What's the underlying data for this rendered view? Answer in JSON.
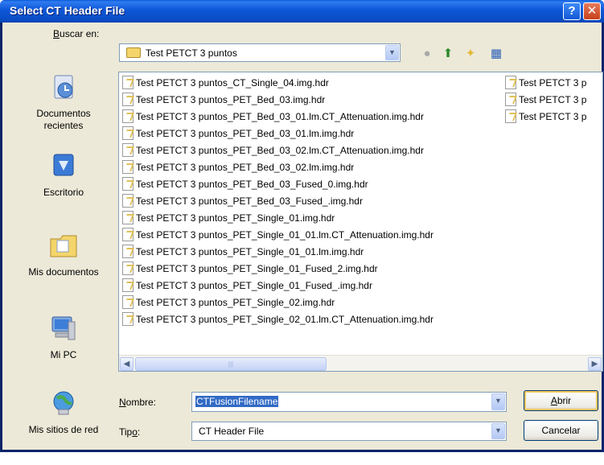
{
  "window": {
    "title": "Select CT Header File"
  },
  "look_in": {
    "label": "Buscar en:",
    "label_first": "B",
    "label_rest": "uscar en:",
    "value": "Test PETCT 3 puntos"
  },
  "places": [
    {
      "label": "Documentos recientes",
      "icon": "recent-documents-icon"
    },
    {
      "label": "Escritorio",
      "icon": "desktop-icon"
    },
    {
      "label": "Mis documentos",
      "icon": "my-documents-icon"
    },
    {
      "label": "Mi PC",
      "icon": "my-computer-icon"
    },
    {
      "label": "Mis sitios de red",
      "icon": "network-places-icon"
    }
  ],
  "files_col1": [
    "Test PETCT 3 puntos_CT_Single_04.img.hdr",
    "Test PETCT 3 puntos_PET_Bed_03.img.hdr",
    "Test PETCT 3 puntos_PET_Bed_03_01.lm.CT_Attenuation.img.hdr",
    "Test PETCT 3 puntos_PET_Bed_03_01.lm.img.hdr",
    "Test PETCT 3 puntos_PET_Bed_03_02.lm.CT_Attenuation.img.hdr",
    "Test PETCT 3 puntos_PET_Bed_03_02.lm.img.hdr",
    "Test PETCT 3 puntos_PET_Bed_03_Fused_0.img.hdr",
    "Test PETCT 3 puntos_PET_Bed_03_Fused_.img.hdr",
    "Test PETCT 3 puntos_PET_Single_01.img.hdr",
    "Test PETCT 3 puntos_PET_Single_01_01.lm.CT_Attenuation.img.hdr",
    "Test PETCT 3 puntos_PET_Single_01_01.lm.img.hdr",
    "Test PETCT 3 puntos_PET_Single_01_Fused_2.img.hdr",
    "Test PETCT 3 puntos_PET_Single_01_Fused_.img.hdr",
    "Test PETCT 3 puntos_PET_Single_02.img.hdr",
    "Test PETCT 3 puntos_PET_Single_02_01.lm.CT_Attenuation.img.hdr"
  ],
  "files_col2": [
    "Test PETCT 3 p",
    "Test PETCT 3 p",
    "Test PETCT 3 p"
  ],
  "filename": {
    "label": "Nombre:",
    "label_first": "N",
    "label_rest": "ombre:",
    "value": "CTFusionFilename"
  },
  "filetype": {
    "label": "Tipo:",
    "label_first": "Tip",
    "label_u": "o",
    "label_rest": ":",
    "value": "CT Header File"
  },
  "buttons": {
    "open": "Abrir",
    "open_first": "A",
    "open_rest": "brir",
    "cancel": "Cancelar"
  },
  "colors": {
    "titlebar": "#0a4fc8",
    "dialog_bg": "#ece9d8",
    "border": "#7f9db9"
  }
}
